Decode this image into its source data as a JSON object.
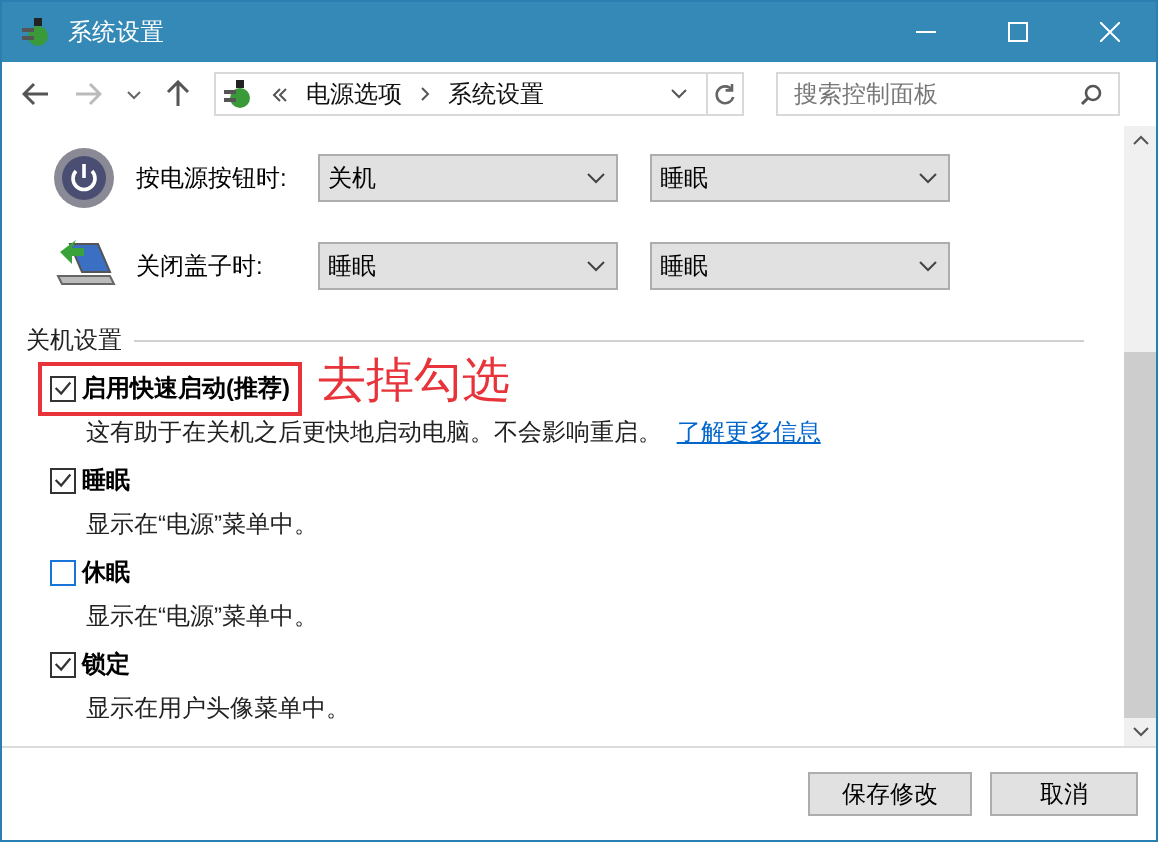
{
  "window": {
    "title": "系统设置"
  },
  "breadcrumb": [
    "电源选项",
    "系统设置"
  ],
  "search": {
    "placeholder": "搜索控制面板"
  },
  "power_rows": [
    {
      "kind": "power-button",
      "label": "按电源按钮时:",
      "values": [
        "关机",
        "睡眠"
      ]
    },
    {
      "kind": "lid",
      "label": "关闭盖子时:",
      "values": [
        "睡眠",
        "睡眠"
      ]
    }
  ],
  "section_title": "关机设置",
  "options": [
    {
      "label": "启用快速启动(推荐)",
      "checked": true,
      "highlighted": true,
      "description": "这有助于在关机之后更快地启动电脑。不会影响重启。",
      "link": "了解更多信息"
    },
    {
      "label": "睡眠",
      "checked": true,
      "highlighted": false,
      "description": "显示在“电源”菜单中。"
    },
    {
      "label": "休眠",
      "checked": false,
      "highlighted": false,
      "description": "显示在“电源”菜单中。"
    },
    {
      "label": "锁定",
      "checked": true,
      "highlighted": false,
      "description": "显示在用户头像菜单中。"
    }
  ],
  "annotation": "去掉勾选",
  "buttons": [
    "保存修改",
    "取消"
  ]
}
